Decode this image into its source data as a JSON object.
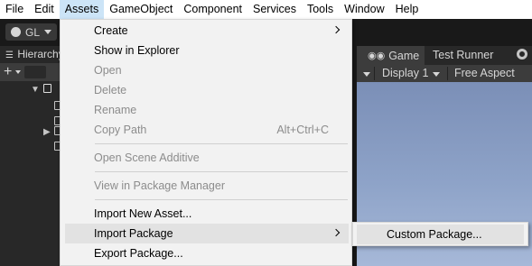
{
  "menubar": {
    "items": [
      "File",
      "Edit",
      "Assets",
      "GameObject",
      "Component",
      "Services",
      "Tools",
      "Window",
      "Help"
    ]
  },
  "toolbar": {
    "account_label": "GL"
  },
  "hierarchy": {
    "tab_label": "Hierarchy"
  },
  "game_panel": {
    "tabs": [
      "Game",
      "Test Runner"
    ],
    "display_label": "Display 1",
    "aspect_label": "Free Aspect"
  },
  "assets_menu": {
    "items": [
      {
        "label": "Create",
        "disabled": false,
        "submenu": true
      },
      {
        "label": "Show in Explorer",
        "disabled": false
      },
      {
        "label": "Open",
        "disabled": true
      },
      {
        "label": "Delete",
        "disabled": true
      },
      {
        "label": "Rename",
        "disabled": true
      },
      {
        "label": "Copy Path",
        "disabled": true,
        "shortcut": "Alt+Ctrl+C"
      },
      {
        "label": "Open Scene Additive",
        "disabled": true
      },
      {
        "label": "View in Package Manager",
        "disabled": true
      },
      {
        "label": "Import New Asset...",
        "disabled": false
      },
      {
        "label": "Import Package",
        "disabled": false,
        "submenu": true,
        "highlighted": true
      },
      {
        "label": "Export Package...",
        "disabled": false
      }
    ]
  },
  "import_package_submenu": {
    "items": [
      "Custom Package..."
    ]
  }
}
